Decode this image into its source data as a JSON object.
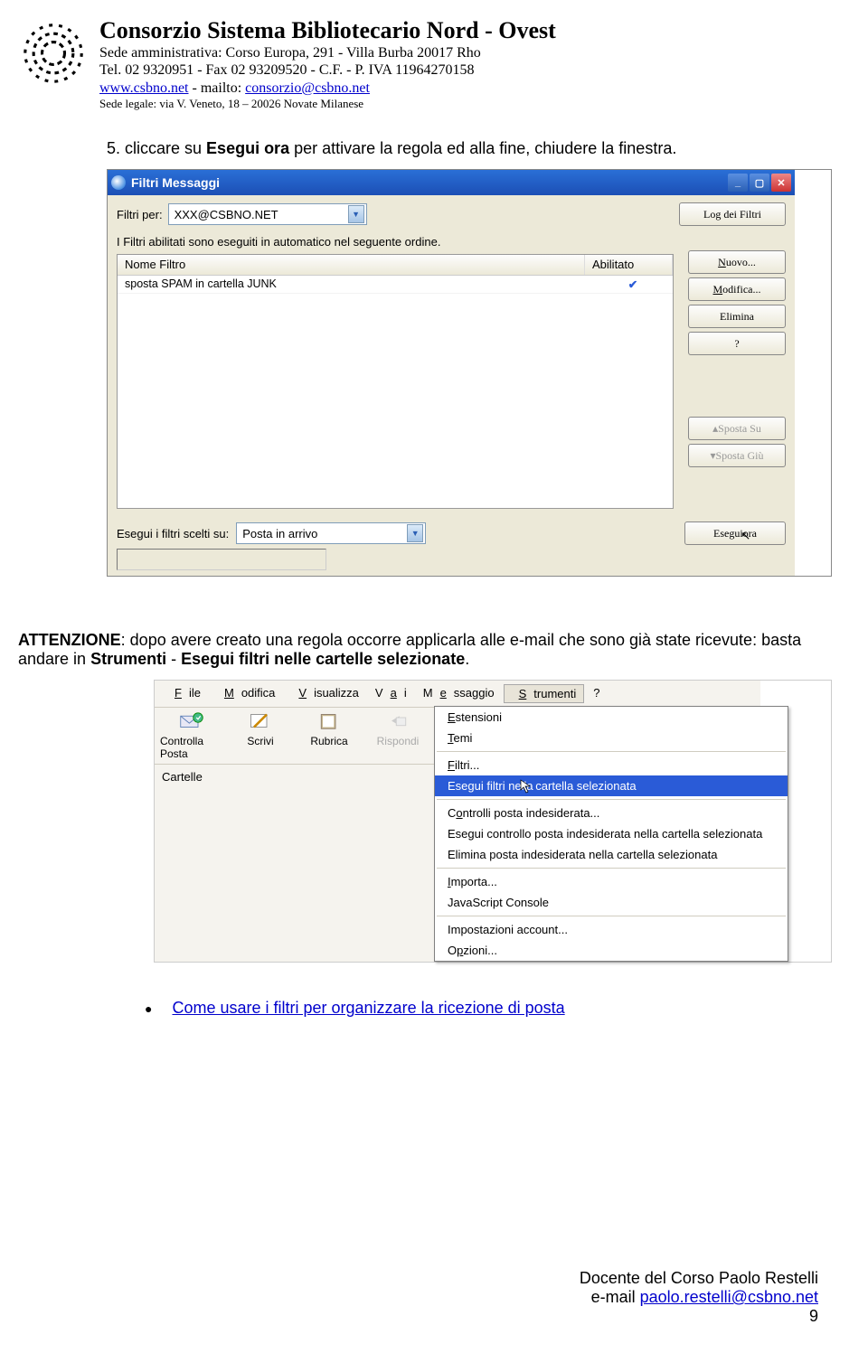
{
  "header": {
    "org_name": "Consorzio Sistema Bibliotecario Nord - Ovest",
    "addr_label": "Sede amministrativa: Corso Europa, 291 -  Villa Burba 20017 Rho",
    "tel": "Tel. 02 9320951 - Fax 02 93209520  - C.F. - P. IVA 11964270158",
    "site": "www.csbno.net",
    "links_sep": " - mailto: ",
    "mail": "consorzio@csbno.net",
    "sede_legale": "Sede legale: via V. Veneto, 18 – 20026 Novate Milanese"
  },
  "step5": {
    "prefix": "5. cliccare su ",
    "bold1": "Esegui ora",
    "rest": " per attivare la regola ed alla fine, chiudere la finestra."
  },
  "dialog": {
    "title": "Filtri Messaggi",
    "filtri_per": "Filtri per:",
    "account": "XXX@CSBNO.NET",
    "log_btn": "Log dei Filtri",
    "caption": "I Filtri abilitati sono eseguiti in automatico nel seguente ordine.",
    "col_nome": "Nome Filtro",
    "col_abil": "Abilitato",
    "row1": "sposta SPAM in cartella JUNK",
    "row1_enabled": "✔",
    "btn_nuovo": "Nuovo...",
    "btn_modifica": "Modifica...",
    "btn_elimina": "Elimina",
    "btn_help": "?",
    "btn_sposta_su": "Sposta Su",
    "btn_sposta_giu": "Sposta Giù",
    "run_label": "Esegui i filtri scelti su:",
    "run_combo": "Posta in arrivo",
    "run_btn": "Esegui ora"
  },
  "attenzione": {
    "bold": "ATTENZIONE",
    "p1": ": dopo avere creato una regola occorre applicarla alle e-mail che sono già state ricevute: basta andare in ",
    "b2": "Strumenti",
    "p2": " - ",
    "b3": "Esegui filtri nelle cartelle selezionate",
    "p3": "."
  },
  "menu2": {
    "file": "File",
    "modifica": "Modifica",
    "visualizza": "Visualizza",
    "vai": "Vai",
    "messaggio": "Messaggio",
    "strumenti": "Strumenti",
    "help": "?",
    "tb_controlla": "Controlla Posta",
    "tb_scrivi": "Scrivi",
    "tb_rubrica": "Rubrica",
    "tb_rispondi": "Rispondi",
    "cartelle": "Cartelle",
    "dd_estensioni": "Estensioni",
    "dd_temi": "Temi",
    "dd_filtri": "Filtri...",
    "dd_esegui_sel": "Esegui filtri nella cartella selezionata",
    "dd_controlli": "Controlli posta indesiderata...",
    "dd_esegui_ctrl": "Esegui controllo posta indesiderata nella cartella selezionata",
    "dd_elimina": "Elimina posta indesiderata nella cartella selezionata",
    "dd_importa": "Importa...",
    "dd_js": "JavaScript Console",
    "dd_account": "Impostazioni account...",
    "dd_opzioni": "Opzioni..."
  },
  "link_filters": "Come usare i filtri per organizzare la ricezione di posta",
  "footer": {
    "docente": "Docente del Corso Paolo Restelli",
    "email_label": "e-mail ",
    "email": "paolo.restelli@csbno.net",
    "page": "9"
  }
}
